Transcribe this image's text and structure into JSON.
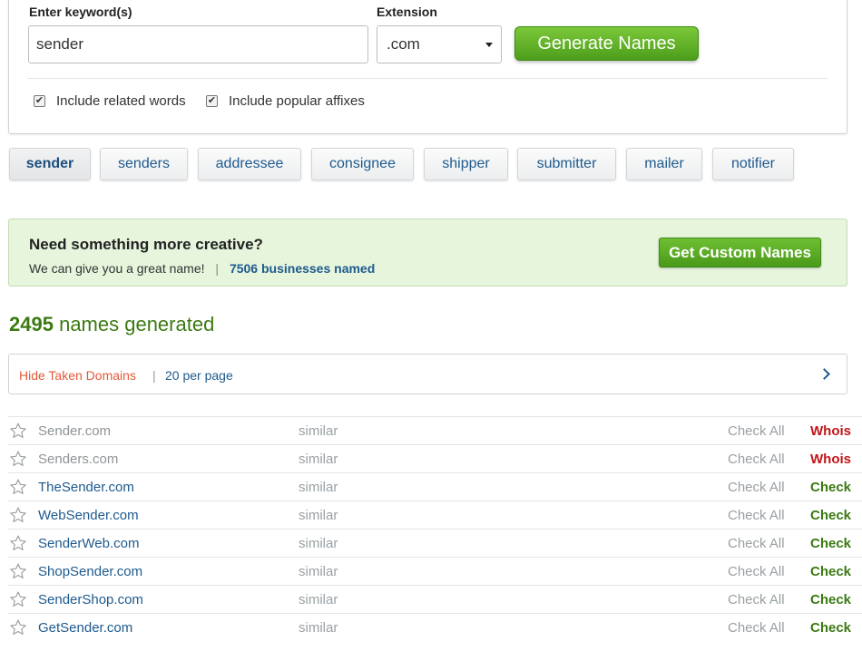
{
  "search": {
    "keyword_label": "Enter keyword(s)",
    "keyword_value": "sender",
    "extension_label": "Extension",
    "extension_value": ".com",
    "generate_label": "Generate Names",
    "option_related": "Include related words",
    "option_affixes": "Include popular affixes"
  },
  "related_words": [
    "sender",
    "senders",
    "addressee",
    "consignee",
    "shipper",
    "submitter",
    "mailer",
    "notifier"
  ],
  "promo": {
    "title": "Need something more creative?",
    "subtitle": "We can give you a great name!",
    "separator": "|",
    "businesses_link": "7506 businesses named",
    "button_label": "Get Custom Names"
  },
  "results_count": {
    "number": "2495",
    "text": "names generated"
  },
  "filter_bar": {
    "hide_taken": "Hide Taken Domains",
    "separator": "|",
    "per_page": "20 per page"
  },
  "results": [
    {
      "name": "Sender.com",
      "similar": "similar",
      "check_all": "Check All",
      "action": "Whois",
      "status": "taken"
    },
    {
      "name": "Senders.com",
      "similar": "similar",
      "check_all": "Check All",
      "action": "Whois",
      "status": "taken"
    },
    {
      "name": "TheSender.com",
      "similar": "similar",
      "check_all": "Check All",
      "action": "Check",
      "status": "avail"
    },
    {
      "name": "WebSender.com",
      "similar": "similar",
      "check_all": "Check All",
      "action": "Check",
      "status": "avail"
    },
    {
      "name": "SenderWeb.com",
      "similar": "similar",
      "check_all": "Check All",
      "action": "Check",
      "status": "avail"
    },
    {
      "name": "ShopSender.com",
      "similar": "similar",
      "check_all": "Check All",
      "action": "Check",
      "status": "avail"
    },
    {
      "name": "SenderShop.com",
      "similar": "similar",
      "check_all": "Check All",
      "action": "Check",
      "status": "avail"
    },
    {
      "name": "GetSender.com",
      "similar": "similar",
      "check_all": "Check All",
      "action": "Check",
      "status": "avail"
    }
  ],
  "icons": {
    "favorite": "star-icon",
    "dropdown": "caret-down-icon",
    "next": "chevron-right-icon",
    "checkbox": "checkbox-icon"
  },
  "colors": {
    "accent_green": "#4c9e1b",
    "link_blue": "#1e5a8e",
    "taken_red": "#c1161b",
    "hide_orange": "#e15a3a",
    "promo_bg": "#e6f5dc"
  }
}
